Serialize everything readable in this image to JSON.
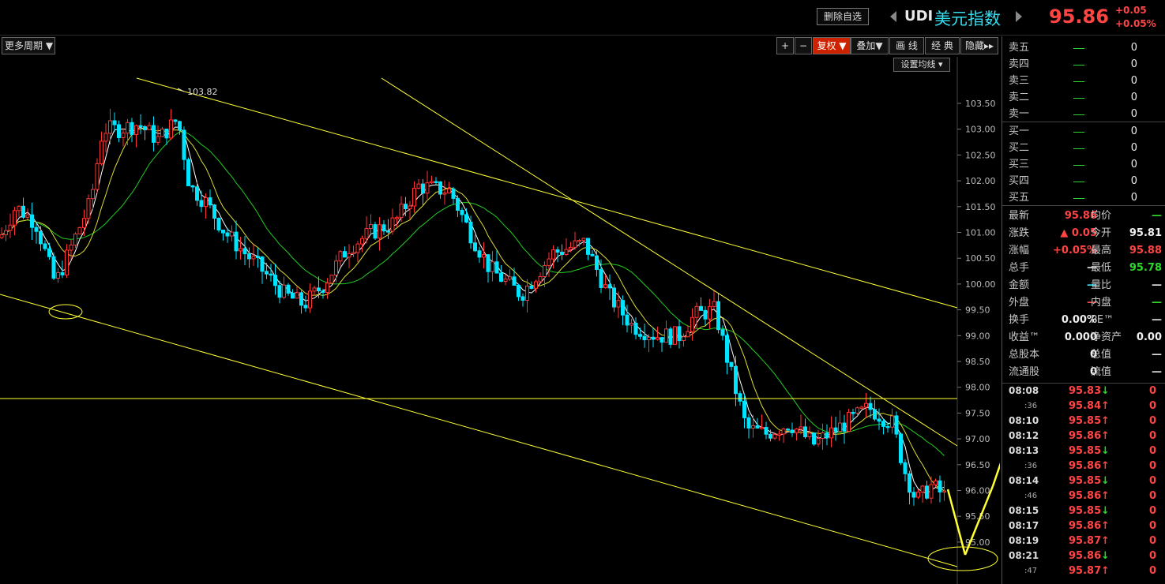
{
  "header": {
    "delete_button": "删除自选",
    "code": "UDI",
    "name": "美元指数",
    "price": "95.86",
    "change": "+0.05",
    "change_pct": "+0.05%"
  },
  "toolbar": {
    "period_label": "更多周期",
    "plus": "+",
    "minus": "−",
    "fuquan": "复权",
    "overlay": "叠加",
    "draw_line": "画 线",
    "classic": "经 典",
    "hide": "隐藏",
    "ma_setting": "设置均线"
  },
  "chart": {
    "peak_label": "103.82",
    "y_ticks": [
      "103.50",
      "103.00",
      "102.50",
      "102.00",
      "101.50",
      "101.00",
      "100.50",
      "100.00",
      "99.50",
      "99.00",
      "98.50",
      "98.00",
      "97.50",
      "97.00",
      "96.50",
      "96.00",
      "95.50",
      "95.00"
    ],
    "colors": {
      "up": "#ff3333",
      "down": "#00e5ff",
      "line": "#ffff33",
      "ma_long": "#22cc22",
      "ma_short": "#ffffff"
    }
  },
  "order_book": {
    "asks": [
      {
        "label": "卖五",
        "qty": "0"
      },
      {
        "label": "卖四",
        "qty": "0"
      },
      {
        "label": "卖三",
        "qty": "0"
      },
      {
        "label": "卖二",
        "qty": "0"
      },
      {
        "label": "卖一",
        "qty": "0"
      }
    ],
    "bids": [
      {
        "label": "买一",
        "qty": "0"
      },
      {
        "label": "买二",
        "qty": "0"
      },
      {
        "label": "买三",
        "qty": "0"
      },
      {
        "label": "买四",
        "qty": "0"
      },
      {
        "label": "买五",
        "qty": "0"
      }
    ]
  },
  "quote": [
    {
      "l1": "最新",
      "v1": "95.86",
      "c1": "#ff4444",
      "l2": "均价",
      "v2": "—",
      "c2": "#2bd82b"
    },
    {
      "l1": "涨跌",
      "v1": "▲ 0.05",
      "c1": "#ff4444",
      "l2": "今开",
      "v2": "95.81",
      "c2": "#eeeeee"
    },
    {
      "l1": "涨幅",
      "v1": "+0.05%",
      "c1": "#ff4444",
      "l2": "最高",
      "v2": "95.88",
      "c2": "#ff4444"
    },
    {
      "l1": "总手",
      "v1": "—",
      "c1": "#dddddd",
      "l2": "最低",
      "v2": "95.78",
      "c2": "#2bd82b"
    },
    {
      "l1": "金额",
      "v1": "—",
      "c1": "#33ddee",
      "l2": "量比",
      "v2": "—",
      "c2": "#dddddd"
    },
    {
      "l1": "外盘",
      "v1": "—",
      "c1": "#ff4444",
      "l2": "内盘",
      "v2": "—",
      "c2": "#2bd82b"
    },
    {
      "l1": "换手",
      "v1": "0.00%",
      "c1": "#eeeeee",
      "l2": "PE™",
      "v2": "—",
      "c2": "#dddddd"
    },
    {
      "l1": "收益™",
      "v1": "0.000",
      "c1": "#eeeeee",
      "l2": "净资产",
      "v2": "0.00",
      "c2": "#eeeeee"
    },
    {
      "l1": "总股本",
      "v1": "0",
      "c1": "#eeeeee",
      "l2": "总值",
      "v2": "—",
      "c2": "#dddddd"
    },
    {
      "l1": "流通股",
      "v1": "0",
      "c1": "#eeeeee",
      "l2": "流值",
      "v2": "—",
      "c2": "#dddddd"
    }
  ],
  "ticks": [
    {
      "time": "08:08",
      "sec": "",
      "price": "95.83",
      "dir": "down",
      "vol": "0"
    },
    {
      "time": "",
      "sec": ":36",
      "price": "95.84",
      "dir": "up",
      "vol": "0"
    },
    {
      "time": "08:10",
      "sec": "",
      "price": "95.85",
      "dir": "up",
      "vol": "0"
    },
    {
      "time": "08:12",
      "sec": "",
      "price": "95.86",
      "dir": "up",
      "vol": "0"
    },
    {
      "time": "08:13",
      "sec": "",
      "price": "95.85",
      "dir": "down",
      "vol": "0"
    },
    {
      "time": "",
      "sec": ":36",
      "price": "95.86",
      "dir": "up",
      "vol": "0"
    },
    {
      "time": "08:14",
      "sec": "",
      "price": "95.85",
      "dir": "down",
      "vol": "0"
    },
    {
      "time": "",
      "sec": ":46",
      "price": "95.86",
      "dir": "up",
      "vol": "0"
    },
    {
      "time": "08:15",
      "sec": "",
      "price": "95.85",
      "dir": "down",
      "vol": "0"
    },
    {
      "time": "08:17",
      "sec": "",
      "price": "95.86",
      "dir": "up",
      "vol": "0"
    },
    {
      "time": "08:19",
      "sec": "",
      "price": "95.87",
      "dir": "up",
      "vol": "0"
    },
    {
      "time": "08:21",
      "sec": "",
      "price": "95.86",
      "dir": "down",
      "vol": "0"
    },
    {
      "time": "",
      "sec": ":47",
      "price": "95.87",
      "dir": "up",
      "vol": "0"
    }
  ]
}
